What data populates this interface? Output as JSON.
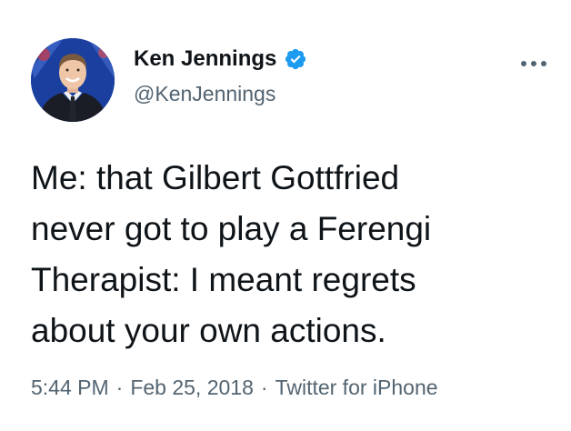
{
  "author": {
    "display_name": "Ken Jennings",
    "handle": "@KenJennings",
    "verified": true,
    "verified_icon": "verified-badge-icon",
    "verified_color": "#1d9bf0"
  },
  "tweet": {
    "lines": [
      "Me: that Gilbert Gottfried",
      "never got to play a Ferengi",
      "Therapist: I meant regrets",
      "about your own actions."
    ]
  },
  "meta": {
    "time": "5:44 PM",
    "separator": "·",
    "date": "Feb 25, 2018",
    "source": "Twitter for iPhone"
  },
  "more_icon": "more-horizontal-icon",
  "colors": {
    "text": "#0f1419",
    "secondary": "#536471",
    "accent": "#1d9bf0",
    "background": "#ffffff"
  }
}
